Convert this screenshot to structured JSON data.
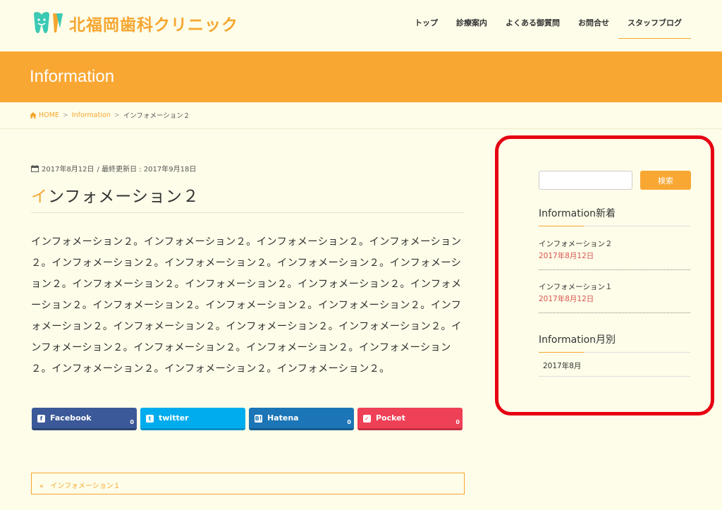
{
  "site": {
    "name": "北福岡歯科クリニック"
  },
  "nav": [
    {
      "label": "トップ",
      "active": false
    },
    {
      "label": "診療案内",
      "active": false
    },
    {
      "label": "よくある御質問",
      "active": false
    },
    {
      "label": "お問合せ",
      "active": false
    },
    {
      "label": "スタッフブログ",
      "active": true
    }
  ],
  "banner": {
    "title": "Information"
  },
  "breadcrumb": {
    "home": "HOME",
    "sep": ">",
    "section": "Information",
    "current": "インフォメーション２"
  },
  "post": {
    "date": "2017年8月12日",
    "updated": "/ 最終更新日 : 2017年9月18日",
    "title_first": "イ",
    "title_rest": "ンフォメーション２",
    "body": "インフォメーション２。インフォメーション２。インフォメーション２。インフォメーション２。インフォメーション２。インフォメーション２。インフォメーション２。インフォメーション２。インフォメーション２。インフォメーション２。インフォメーション２。インフォメーション２。インフォメーション２。インフォメーション２。インフォメーション２。インフォメーション２。インフォメーション２。インフォメーション２。インフォメーション２。インフォメーション２。インフォメーション２。インフォメーション２。インフォメーション２。インフォメーション２。インフォメーション２。インフォメーション２。"
  },
  "share": {
    "facebook": {
      "label": "Facebook",
      "count": "0",
      "color": "#3b5998"
    },
    "twitter": {
      "label": "twitter",
      "color": "#00acee"
    },
    "hatena": {
      "label": "Hatena",
      "count": "0",
      "color": "#1b75b6"
    },
    "pocket": {
      "label": "Pocket",
      "count": "0",
      "color": "#ee4056"
    }
  },
  "prev_post": {
    "arrow": "«",
    "label": "インフォメーション１"
  },
  "sidebar": {
    "search_button": "検索",
    "recent_title": "Information新着",
    "recent": [
      {
        "title": "インフォメーション２",
        "date": "2017年8月12日"
      },
      {
        "title": "インフォメーション１",
        "date": "2017年8月12日"
      }
    ],
    "archive_title": "Information月別",
    "archives": [
      "2017年8月"
    ]
  },
  "colors": {
    "accent": "#f9a733",
    "background": "#fefde9",
    "highlight_border": "#e60012",
    "date_red": "#d9534f"
  }
}
